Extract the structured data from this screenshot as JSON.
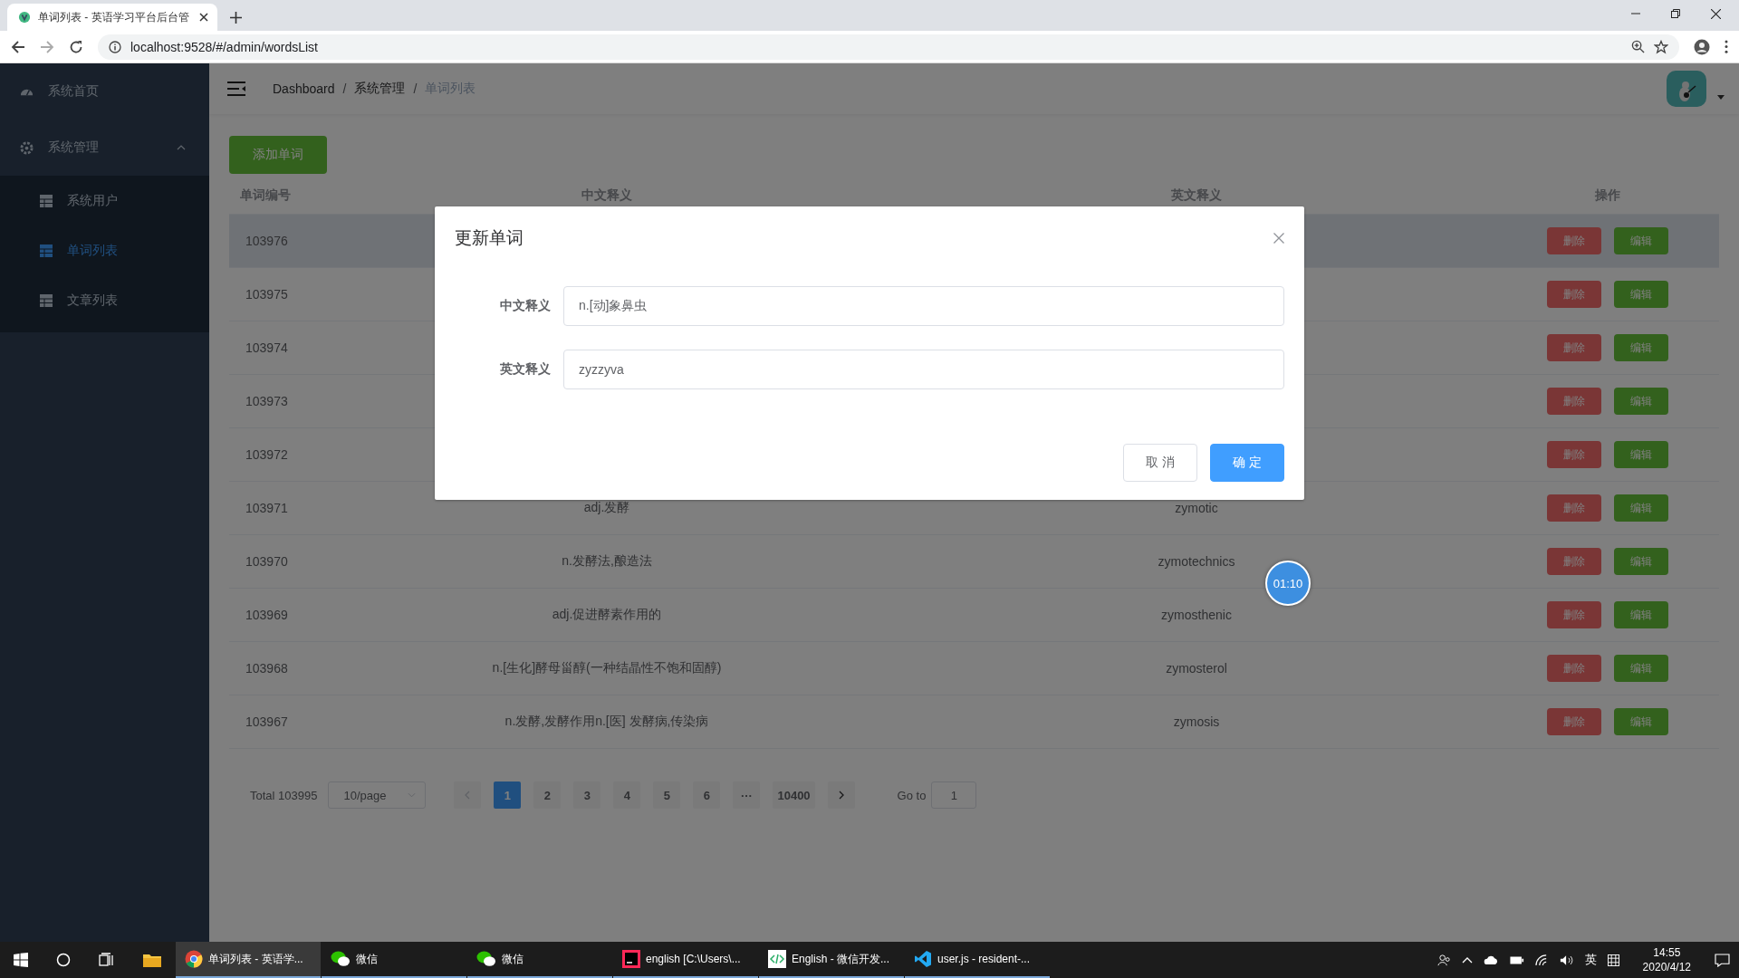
{
  "browser": {
    "tab_title": "单词列表 - 英语学习平台后台管",
    "url": "localhost:9528/#/admin/wordsList"
  },
  "sidebar": {
    "items": [
      {
        "label": "系统首页",
        "kind": "dashboard",
        "selected": false
      },
      {
        "label": "系统管理",
        "kind": "gear",
        "selected": false,
        "expanded": true,
        "children": [
          {
            "label": "系统用户",
            "kind": "table",
            "selected": false
          },
          {
            "label": "单词列表",
            "kind": "table",
            "selected": true
          },
          {
            "label": "文章列表",
            "kind": "table",
            "selected": false
          }
        ]
      }
    ]
  },
  "breadcrumb": [
    "Dashboard",
    "系统管理",
    "单词列表"
  ],
  "breadcrumb_separator": "/",
  "add_button": "添加单词",
  "table": {
    "columns": [
      "单词编号",
      "中文释义",
      "英文释义",
      "操作"
    ],
    "rows": [
      {
        "id": "103976",
        "hovered": true,
        "actions": [
          {
            "label": "删除",
            "kind": "danger"
          },
          {
            "label": "编辑",
            "kind": "success"
          }
        ]
      },
      {
        "id": "103975",
        "hovered": false,
        "actions": [
          {
            "label": "删除",
            "kind": "danger"
          },
          {
            "label": "编辑",
            "kind": "success"
          }
        ]
      },
      {
        "id": "103974",
        "hovered": false,
        "actions": [
          {
            "label": "删除",
            "kind": "danger"
          },
          {
            "label": "编辑",
            "kind": "success"
          }
        ]
      },
      {
        "id": "103973",
        "hovered": false,
        "actions": [
          {
            "label": "删除",
            "kind": "danger"
          },
          {
            "label": "编辑",
            "kind": "success"
          }
        ]
      },
      {
        "id": "103972",
        "hovered": false,
        "actions": [
          {
            "label": "删除",
            "kind": "danger"
          },
          {
            "label": "编辑",
            "kind": "success"
          }
        ]
      },
      {
        "id": "103971",
        "chinese": "adj.发酵",
        "english": "zymotic",
        "hovered": false,
        "actions": [
          {
            "label": "删除",
            "kind": "danger"
          },
          {
            "label": "编辑",
            "kind": "success"
          }
        ]
      },
      {
        "id": "103970",
        "chinese": "n.发酵法,酿造法",
        "english": "zymotechnics",
        "hovered": false,
        "actions": [
          {
            "label": "删除",
            "kind": "danger"
          },
          {
            "label": "编辑",
            "kind": "success"
          }
        ]
      },
      {
        "id": "103969",
        "chinese": "adj.促进酵素作用的",
        "english": "zymosthenic",
        "hovered": false,
        "actions": [
          {
            "label": "删除",
            "kind": "danger"
          },
          {
            "label": "编辑",
            "kind": "success"
          }
        ]
      },
      {
        "id": "103968",
        "chinese": "n.[生化]酵母甾醇(一种结晶性不饱和固醇)",
        "english": "zymosterol",
        "hovered": false,
        "actions": [
          {
            "label": "删除",
            "kind": "danger"
          },
          {
            "label": "编辑",
            "kind": "success"
          }
        ]
      },
      {
        "id": "103967",
        "chinese": "n.发酵,发酵作用n.[医] 发酵病,传染病",
        "english": "zymosis",
        "hovered": false,
        "actions": [
          {
            "label": "删除",
            "kind": "danger"
          },
          {
            "label": "编辑",
            "kind": "success"
          }
        ]
      }
    ]
  },
  "pagination": {
    "total": "Total 103995",
    "page_size": "10/page",
    "pages": [
      {
        "label": "1",
        "selected": true
      },
      {
        "label": "2",
        "selected": false
      },
      {
        "label": "3",
        "selected": false
      },
      {
        "label": "4",
        "selected": false
      },
      {
        "label": "5",
        "selected": false
      },
      {
        "label": "6",
        "selected": false
      },
      {
        "label": "···",
        "selected": false
      },
      {
        "label": "10400",
        "selected": false
      }
    ],
    "goto_label": "Go to",
    "goto_value": "1"
  },
  "dialog": {
    "title": "更新单词",
    "fields": [
      {
        "label": "中文释义",
        "value": "n.[动]象鼻虫"
      },
      {
        "label": "英文释义",
        "value": "zyzzyva"
      }
    ],
    "buttons": [
      {
        "label": "取 消",
        "kind": "default"
      },
      {
        "label": "确 定",
        "kind": "primary"
      }
    ]
  },
  "timer_badge": "01:10",
  "taskbar": {
    "items": [
      {
        "label": "单词列表 - 英语学...",
        "kind": "chrome",
        "active": true
      },
      {
        "label": "微信",
        "kind": "wechat",
        "active": false
      },
      {
        "label": "微信",
        "kind": "wechat",
        "active": false
      },
      {
        "label": "english [C:\\Users\\...",
        "kind": "idea",
        "active": false
      },
      {
        "label": "English - 微信开发...",
        "kind": "devtools",
        "active": false
      },
      {
        "label": "user.js - resident-...",
        "kind": "vscode",
        "active": false
      }
    ],
    "ime": "英",
    "time": "14:55",
    "date": "2020/4/12"
  }
}
